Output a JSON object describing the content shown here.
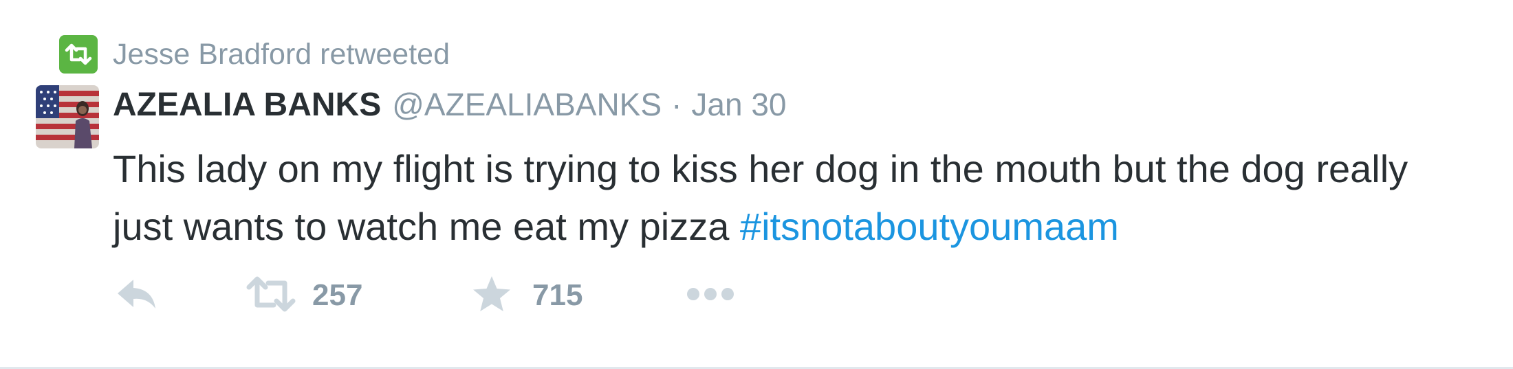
{
  "retweet_context": {
    "text": "Jesse Bradford retweeted",
    "icon": "retweet-icon",
    "color": "#5bb543"
  },
  "tweet": {
    "author_name": "AZEALIA BANKS",
    "handle": "@AZEALIABANKS",
    "separator": "·",
    "date": "Jan 30",
    "text": "This lady on my flight is trying to kiss her dog in the mouth but the dog really just wants to watch me eat my pizza",
    "hashtag": "#itsnotaboutyoumaam",
    "hashtag_color": "#1b95e0"
  },
  "actions": {
    "reply_icon": "reply-icon",
    "retweet_icon": "retweet-icon",
    "retweet_count": "257",
    "favorite_icon": "star-icon",
    "favorite_count": "715",
    "more_icon": "more-icon"
  },
  "colors": {
    "text": "#292f33",
    "muted": "#8899a6",
    "action_icon": "#ccd6dd"
  }
}
